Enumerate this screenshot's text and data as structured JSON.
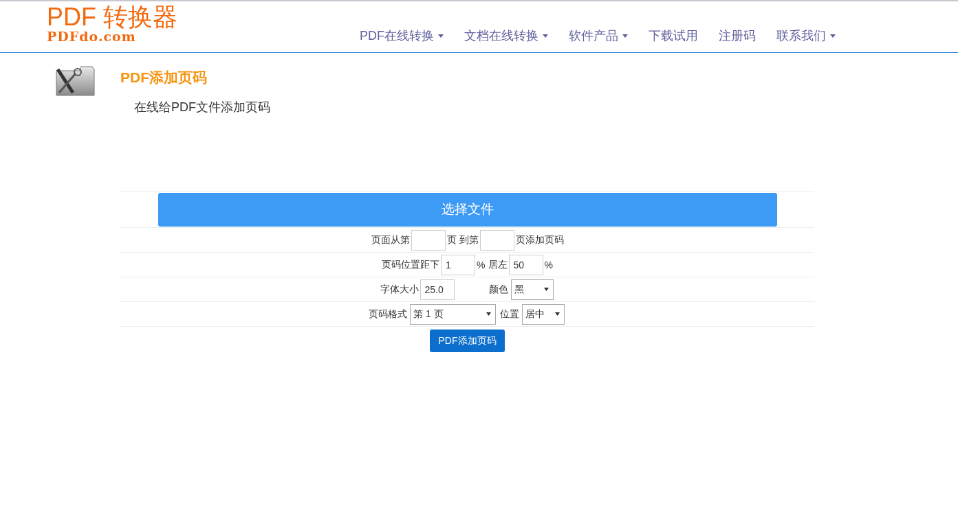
{
  "logo": {
    "title": "PDF 转换器",
    "subtitle": "PDFdo.com"
  },
  "nav": [
    {
      "label": "PDF在线转换",
      "dropdown": true
    },
    {
      "label": "文档在线转换",
      "dropdown": true
    },
    {
      "label": "软件产品",
      "dropdown": true
    },
    {
      "label": "下载试用",
      "dropdown": false
    },
    {
      "label": "注册码",
      "dropdown": false
    },
    {
      "label": "联系我们",
      "dropdown": true
    }
  ],
  "tool": {
    "title": "PDF添加页码",
    "description": "在线给PDF文件添加页码"
  },
  "file_button": "选择文件",
  "form_rows": [
    [
      {
        "kind": "text",
        "text": "页面从第"
      },
      {
        "kind": "input"
      },
      {
        "kind": "text",
        "text": "页"
      },
      {
        "kind": "text",
        "text": "到第"
      },
      {
        "kind": "input"
      },
      {
        "kind": "text",
        "text": "页添加页码"
      }
    ],
    [
      {
        "kind": "text",
        "text": "页码位置距下"
      },
      {
        "kind": "input",
        "value": "1"
      },
      {
        "kind": "text",
        "text": "%"
      },
      {
        "kind": "text",
        "text": "居左"
      },
      {
        "kind": "input",
        "value": "50"
      },
      {
        "kind": "text",
        "text": "%"
      }
    ],
    [
      {
        "kind": "text",
        "text": "字体大小"
      },
      {
        "kind": "input",
        "value": "25.0"
      },
      {
        "kind": "spacer"
      },
      {
        "kind": "text",
        "text": "颜色"
      },
      {
        "kind": "select",
        "value": "黑"
      }
    ],
    [
      {
        "kind": "text",
        "text": "页码格式"
      },
      {
        "kind": "wideselect",
        "value": "第 1 页"
      },
      {
        "kind": "text",
        "text": "位置"
      },
      {
        "kind": "select",
        "value": "居中"
      }
    ]
  ],
  "submit_button": "PDF添加页码"
}
